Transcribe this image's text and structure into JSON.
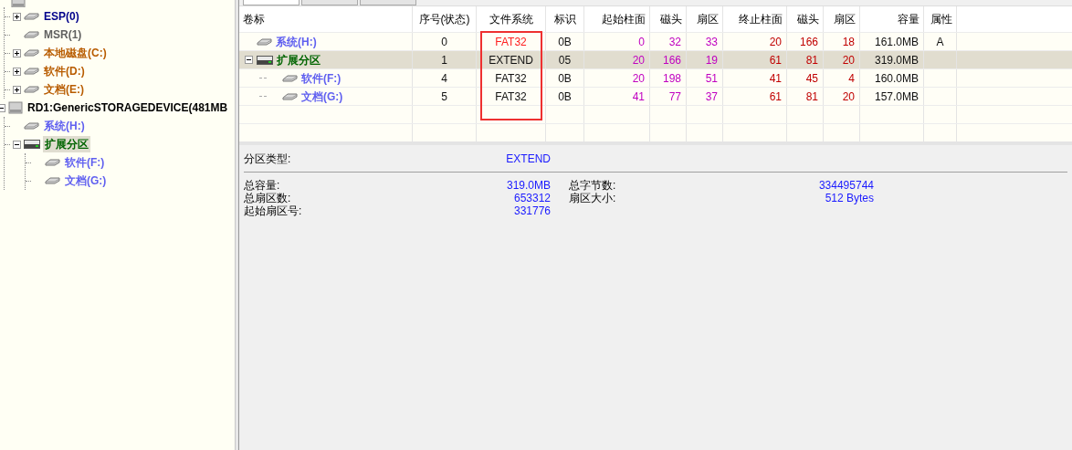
{
  "tree": [
    {
      "kind": "disk",
      "children": [
        {
          "label": "ESP(0)",
          "kind": "drive",
          "expanded": false,
          "selected": false,
          "color": "#00008b"
        },
        {
          "label": "MSR(1)",
          "kind": "drive",
          "selected": false,
          "color": "#606060"
        },
        {
          "label": "本地磁盘(C:)",
          "kind": "drive",
          "expanded": false,
          "selected": false,
          "color": "#b85c00"
        },
        {
          "label": "软件(D:)",
          "kind": "drive",
          "expanded": false,
          "selected": false,
          "color": "#b85c00"
        },
        {
          "label": "文档(E:)",
          "kind": "drive",
          "expanded": false,
          "selected": false,
          "color": "#b85c00"
        }
      ]
    },
    {
      "label": "RD1:GenericSTORAGEDEVICE(481MB",
      "kind": "disk",
      "expanded": true,
      "color": "#000000",
      "children": [
        {
          "label": "系统(H:)",
          "kind": "drive",
          "selected": false,
          "color": "#6060f0"
        },
        {
          "label": "扩展分区",
          "kind": "extended",
          "expanded": true,
          "selected": true,
          "color": "#006400",
          "children": [
            {
              "label": "软件(F:)",
              "kind": "drive",
              "selected": false,
              "color": "#6060f0"
            },
            {
              "label": "文档(G:)",
              "kind": "drive",
              "selected": false,
              "color": "#6060f0"
            }
          ]
        }
      ]
    }
  ],
  "tabs": [
    {
      "selected": true
    },
    {
      "selected": false
    },
    {
      "selected": false
    }
  ],
  "table": {
    "columns": [
      "卷标",
      "序号(状态)",
      "文件系统",
      "标识",
      "起始柱面",
      "磁头",
      "扇区",
      "终止柱面",
      "磁头",
      "扇区",
      "容量",
      "属性"
    ],
    "rows": [
      {
        "kind": "drive",
        "selected": false,
        "color": "#6060f0",
        "cells": [
          "系统(H:)",
          "0",
          "FAT32",
          "0B",
          "0",
          "32",
          "33",
          "20",
          "166",
          "18",
          "161.0MB",
          "A"
        ],
        "fs_alert": true
      },
      {
        "kind": "extended",
        "expanded": true,
        "selected": true,
        "color": "#006400",
        "cells": [
          "扩展分区",
          "1",
          "EXTEND",
          "05",
          "20",
          "166",
          "19",
          "61",
          "81",
          "20",
          "319.0MB",
          ""
        ],
        "fs_alert": false,
        "children": [
          {
            "kind": "drive",
            "selected": false,
            "color": "#6060f0",
            "cells": [
              "软件(F:)",
              "4",
              "FAT32",
              "0B",
              "20",
              "198",
              "51",
              "41",
              "45",
              "4",
              "160.0MB",
              ""
            ],
            "fs_alert": false
          },
          {
            "kind": "drive",
            "selected": false,
            "color": "#6060f0",
            "cells": [
              "文档(G:)",
              "5",
              "FAT32",
              "0B",
              "41",
              "77",
              "37",
              "61",
              "81",
              "20",
              "157.0MB",
              ""
            ],
            "fs_alert": false
          }
        ]
      }
    ]
  },
  "details": {
    "type": {
      "label": "分区类型:",
      "value": "EXTEND"
    },
    "left": [
      {
        "label": "总容量:",
        "value": "319.0MB"
      },
      {
        "label": "总扇区数:",
        "value": "653312"
      },
      {
        "label": "起始扇区号:",
        "value": "331776"
      }
    ],
    "right": [
      {
        "label": "总字节数:",
        "value": "334495744"
      },
      {
        "label": "扇区大小:",
        "value": "512 Bytes"
      }
    ]
  }
}
